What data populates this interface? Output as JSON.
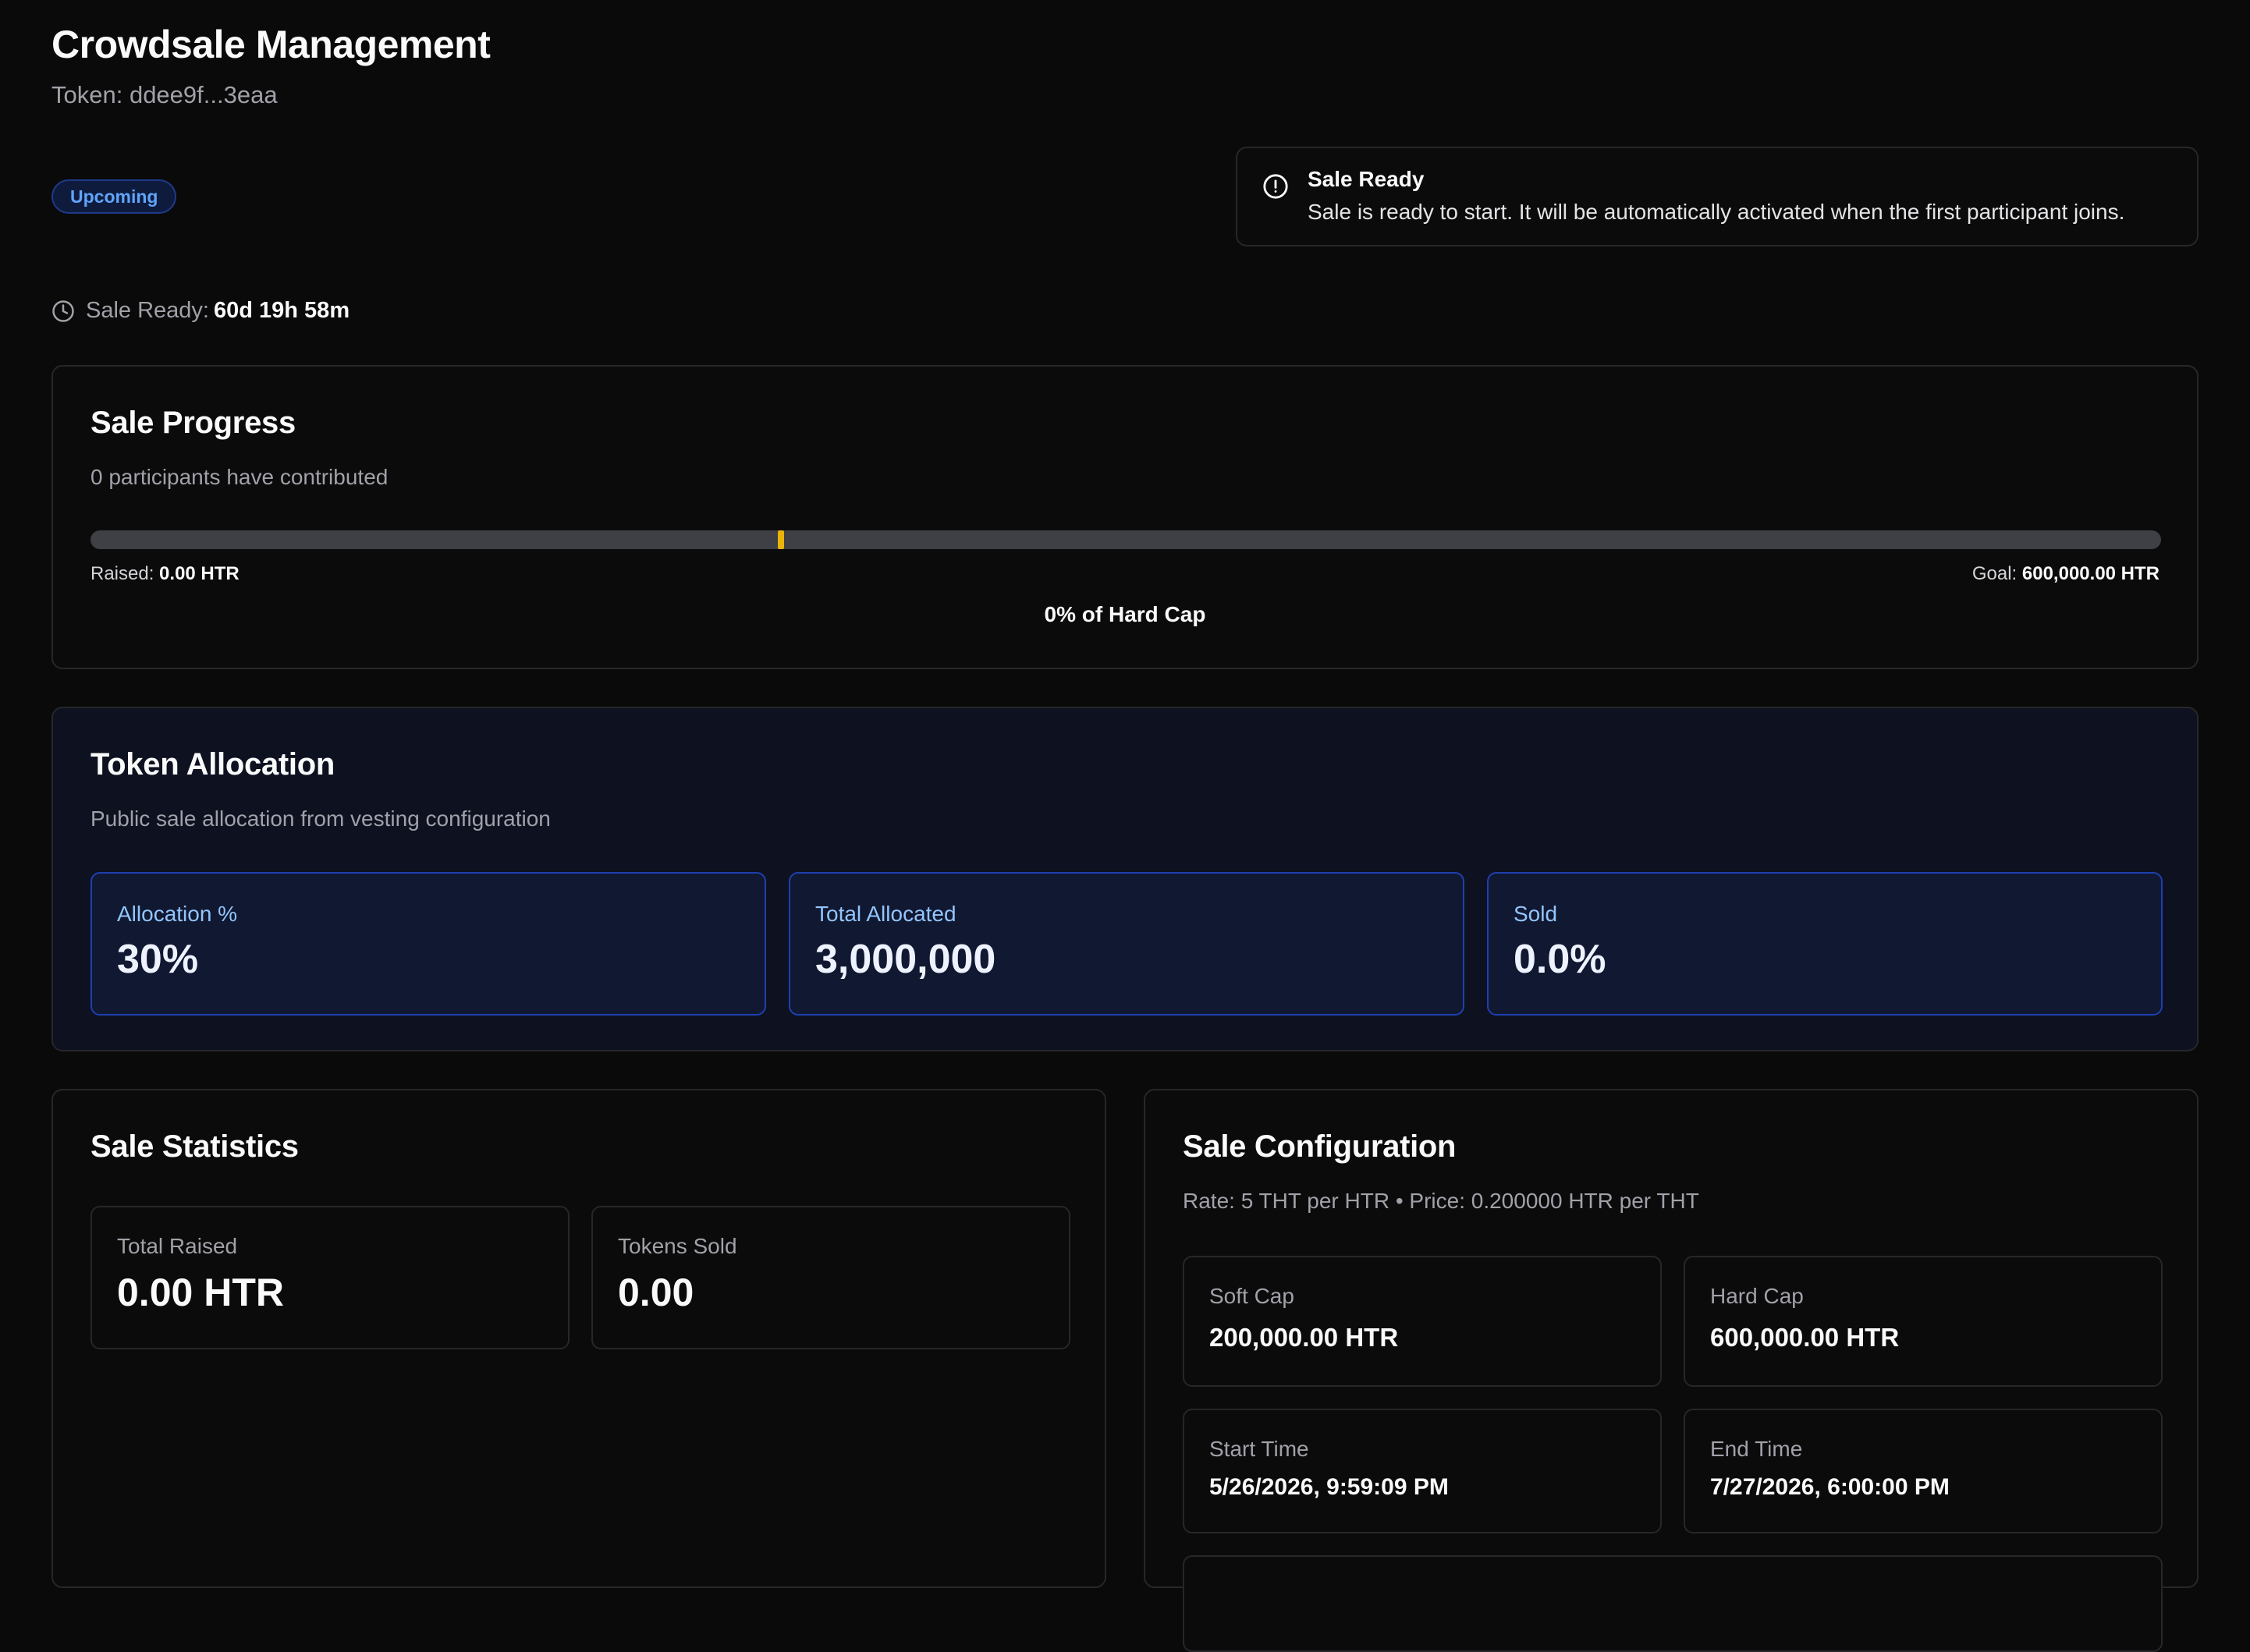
{
  "header": {
    "title": "Crowdsale Management",
    "token_line": "Token: ddee9f...3eaa",
    "status_badge": "Upcoming"
  },
  "alert": {
    "icon": "alert-circle-icon",
    "title": "Sale Ready",
    "message": "Sale is ready to start. It will be automatically activated when the first participant joins."
  },
  "countdown": {
    "icon": "clock-icon",
    "label": "Sale Ready:",
    "value": "60d 19h 58m"
  },
  "progress": {
    "title": "Sale Progress",
    "description": "0 participants have contributed",
    "raised_label": "Raised:",
    "raised_value": "0.00 HTR",
    "goal_label": "Goal:",
    "goal_value": "600,000.00 HTR",
    "percent_text": "0% of Hard Cap",
    "fill_fraction": 0,
    "soft_cap_marker_fraction": 0.3333,
    "fill_color": "#eab308"
  },
  "allocation": {
    "title": "Token Allocation",
    "description": "Public sale allocation from vesting configuration",
    "stats": [
      {
        "label": "Allocation %",
        "value": "30%"
      },
      {
        "label": "Total Allocated",
        "value": "3,000,000"
      },
      {
        "label": "Sold",
        "value": "0.0%"
      }
    ]
  },
  "statistics": {
    "title": "Sale Statistics",
    "items": [
      {
        "label": "Total Raised",
        "value": "0.00 HTR"
      },
      {
        "label": "Tokens Sold",
        "value": "0.00"
      }
    ]
  },
  "configuration": {
    "title": "Sale Configuration",
    "rate_line": "Rate: 5 THT per HTR • Price: 0.200000 HTR per THT",
    "items": [
      {
        "label": "Soft Cap",
        "value": "200,000.00 HTR"
      },
      {
        "label": "Hard Cap",
        "value": "600,000.00 HTR"
      },
      {
        "label": "Start Time",
        "value": "5/26/2026, 9:59:09 PM"
      },
      {
        "label": "End Time",
        "value": "7/27/2026, 6:00:00 PM"
      }
    ]
  },
  "colors": {
    "background": "#0a0a0a",
    "accent_blue": "#60a5fa",
    "progress_yellow": "#eab308"
  }
}
